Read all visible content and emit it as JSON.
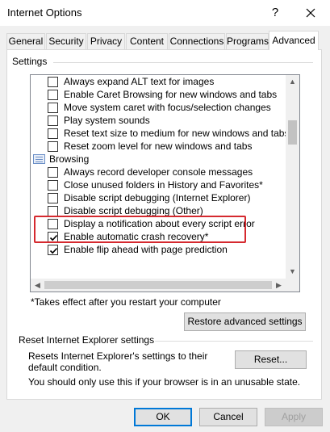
{
  "window": {
    "title": "Internet Options",
    "help_label": "?",
    "close_icon": "close-icon"
  },
  "tabs": [
    {
      "label": "General"
    },
    {
      "label": "Security"
    },
    {
      "label": "Privacy"
    },
    {
      "label": "Content"
    },
    {
      "label": "Connections"
    },
    {
      "label": "Programs"
    },
    {
      "label": "Advanced",
      "active": true
    }
  ],
  "settings": {
    "legend": "Settings",
    "items": [
      {
        "label": "Always expand ALT text for images",
        "checked": false
      },
      {
        "label": "Enable Caret Browsing for new windows and tabs",
        "checked": false
      },
      {
        "label": "Move system caret with focus/selection changes",
        "checked": false
      },
      {
        "label": "Play system sounds",
        "checked": false
      },
      {
        "label": "Reset text size to medium for new windows and tabs",
        "checked": false
      },
      {
        "label": "Reset zoom level for new windows and tabs",
        "checked": false
      },
      {
        "label": "Browsing",
        "category": true
      },
      {
        "label": "Always record developer console messages",
        "checked": false
      },
      {
        "label": "Close unused folders in History and Favorites*",
        "checked": false
      },
      {
        "label": "Disable script debugging (Internet Explorer)",
        "checked": false
      },
      {
        "label": "Disable script debugging (Other)",
        "checked": false
      },
      {
        "label": "Display a notification about every script error",
        "checked": false
      },
      {
        "label": "Enable automatic crash recovery*",
        "checked": true
      },
      {
        "label": "Enable flip ahead with page prediction",
        "checked": true
      }
    ],
    "note": "*Takes effect after you restart your computer",
    "restore_button": "Restore advanced settings"
  },
  "reset": {
    "legend": "Reset Internet Explorer settings",
    "description": "Resets Internet Explorer's settings to their default condition.",
    "button": "Reset...",
    "warning": "You should only use this if your browser is in an unusable state."
  },
  "footer": {
    "ok": "OK",
    "cancel": "Cancel",
    "apply": "Apply"
  },
  "colors": {
    "highlight_border": "#d5292f",
    "default_button_border": "#0078d7"
  }
}
